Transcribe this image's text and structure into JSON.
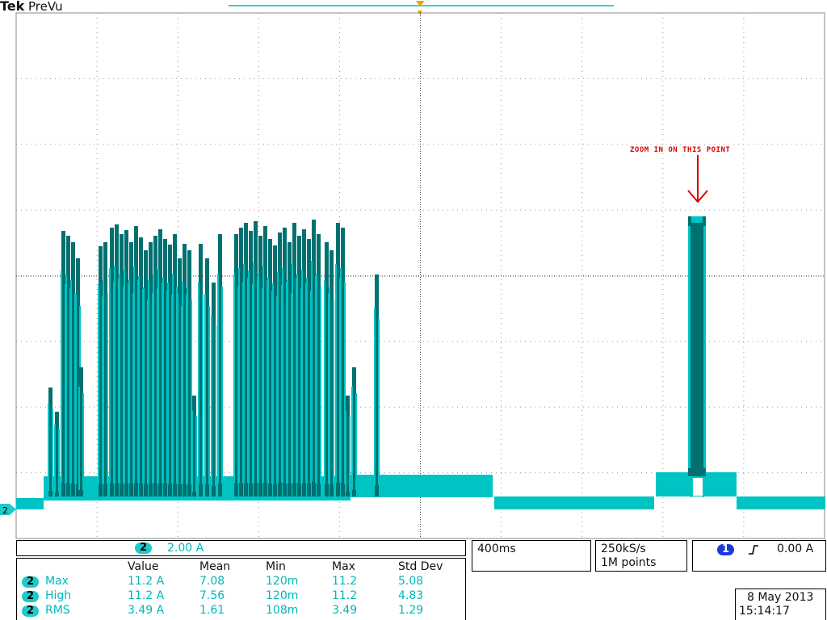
{
  "header": {
    "brand": "Tek",
    "mode": "PreVu"
  },
  "channel_marker": "2",
  "annotation": {
    "text": "ZOOM IN ON THIS POINT"
  },
  "scale_box": {
    "channel": "2",
    "scale": "2.00 A"
  },
  "timebase": {
    "value": "400ms"
  },
  "acquisition": {
    "rate": "250kS/s",
    "points": "1M points"
  },
  "trigger": {
    "channel": "1",
    "level": "0.00 A"
  },
  "measurements": {
    "headers": [
      "Value",
      "Mean",
      "Min",
      "Max",
      "Std Dev"
    ],
    "rows": [
      {
        "ch": "2",
        "name": "Max",
        "value": "11.2 A",
        "mean": "7.08",
        "min": "120m",
        "max": "11.2",
        "std": "5.08"
      },
      {
        "ch": "2",
        "name": "High",
        "value": "11.2 A",
        "mean": "7.56",
        "min": "120m",
        "max": "11.2",
        "std": "4.83"
      },
      {
        "ch": "2",
        "name": "RMS",
        "value": "3.49 A",
        "mean": "1.61",
        "min": "108m",
        "max": "3.49",
        "std": "1.29"
      }
    ]
  },
  "datetime": {
    "date": "8 May 2013",
    "time": "15:14:17"
  },
  "colors": {
    "trace": "#00c4c4",
    "trace_dark": "#007070",
    "annotation": "#e00000",
    "trigger_marker": "#f0a000"
  }
}
